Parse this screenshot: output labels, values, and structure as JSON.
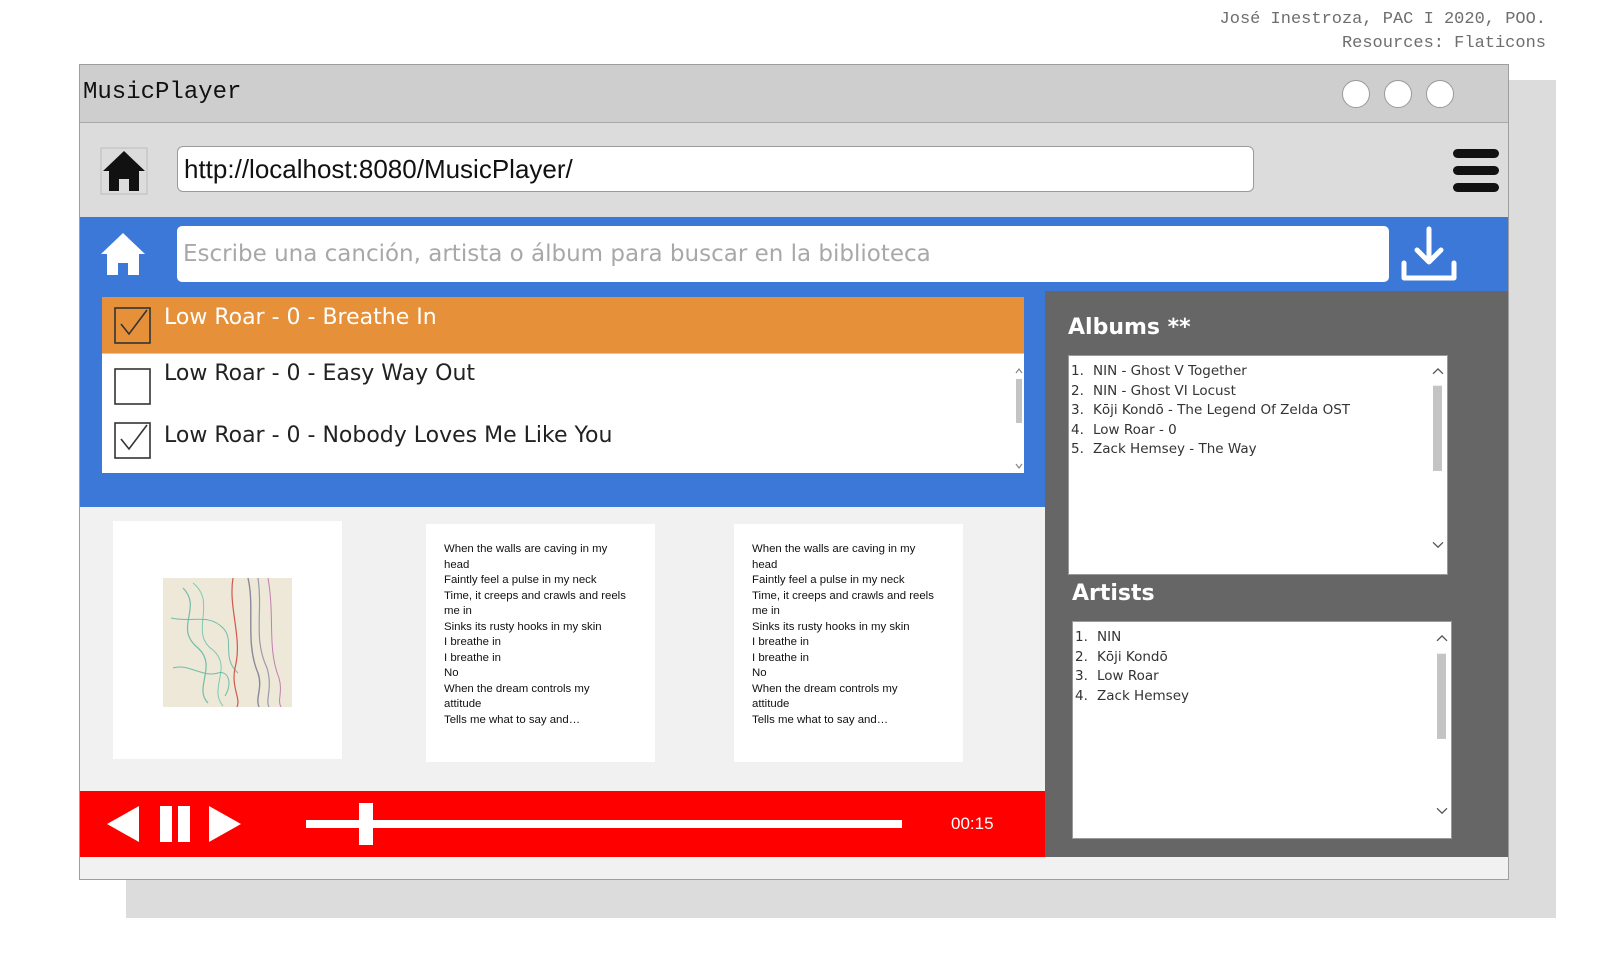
{
  "credit": {
    "line1": "José Inestroza, PAC I 2020, POO.",
    "line2": "Resources: Flaticons"
  },
  "window": {
    "title": "MusicPlayer"
  },
  "browser": {
    "url": "http://localhost:8080/MusicPlayer/"
  },
  "search": {
    "placeholder": "Escribe una canción, artista o álbum para buscar en la biblioteca"
  },
  "tracks": [
    {
      "label": "Low Roar - 0 - Breathe In",
      "checked": true,
      "active": true
    },
    {
      "label": "Low Roar - 0 - Easy Way Out",
      "checked": false,
      "active": false
    },
    {
      "label": "Low Roar - 0 - Nobody Loves Me Like You",
      "checked": true,
      "active": false
    }
  ],
  "lyrics": {
    "card1": "When the walls are caving in my\nhead\nFaintly feel a pulse in my neck\nTime, it creeps and crawls and reels\nme in\nSinks its rusty hooks in my skin\nI breathe in\nI breathe in\nNo\nWhen the dream controls my\nattitude\nTells me what to say and…",
    "card2": "When the walls are caving in my\nhead\nFaintly feel a pulse in my neck\nTime, it creeps and crawls and reels\nme in\nSinks its rusty hooks in my skin\nI breathe in\nI breathe in\nNo\nWhen the dream controls my\nattitude\nTells me what to say and…"
  },
  "player": {
    "time": "00:15",
    "progress": 0.1
  },
  "albums": {
    "title": "Albums **",
    "items": [
      {
        "n": "1.",
        "text": "NIN - Ghost V Together"
      },
      {
        "n": "2.",
        "text": "NIN - Ghost VI Locust"
      },
      {
        "n": "3.",
        "text": "Kōji Kondō - The Legend Of Zelda OST"
      },
      {
        "n": "4.",
        "text": "Low Roar - 0"
      },
      {
        "n": "5.",
        "text": "Zack Hemsey - The Way"
      }
    ]
  },
  "artists": {
    "title": "Artists",
    "items": [
      {
        "n": "1.",
        "text": "NIN"
      },
      {
        "n": "2.",
        "text": "Kōji Kondō"
      },
      {
        "n": "3.",
        "text": "Low Roar"
      },
      {
        "n": "4.",
        "text": "Zack Hemsey"
      }
    ]
  },
  "colors": {
    "accent_blue": "#3b78d8",
    "active_track": "#e69139",
    "player_red": "#ff0000",
    "sidebar_gray": "#666666"
  }
}
